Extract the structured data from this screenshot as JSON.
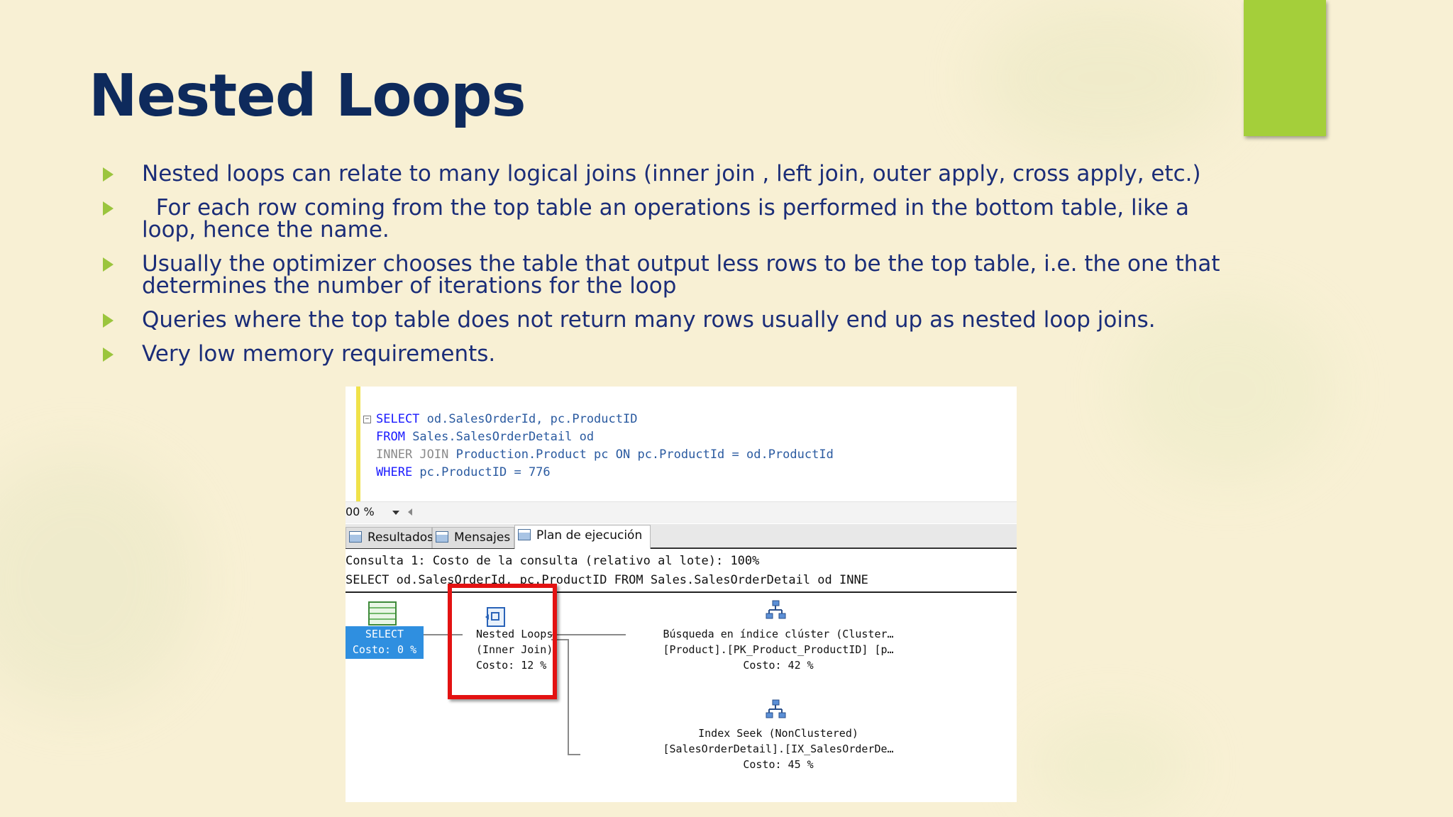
{
  "slide": {
    "title": "Nested Loops",
    "bullets": [
      "Nested loops can relate to many logical joins (inner join , left join, outer apply, cross apply, etc.)",
      "  For each row coming from the top table an operations is performed in the bottom table, like a loop, hence the name.",
      "Usually the optimizer chooses the table that output less rows to be the top table, i.e. the one that determines the number of iterations for the loop",
      "Queries where the top table does not return many rows usually end up as nested loop joins.",
      "Very low memory requirements."
    ],
    "colors": {
      "title": "#0e2a5c",
      "text": "#1b2d78",
      "accent": "#a4cf3a",
      "background": "#f8f0d4"
    }
  },
  "screenshot": {
    "editor": {
      "lines": [
        {
          "kw": "SELECT",
          "rest": " od.SalesOrderId, pc.ProductID"
        },
        {
          "kw": "FROM",
          "rest": " Sales.SalesOrderDetail od"
        },
        {
          "kw": "INNER JOIN",
          "rest": " Production.Product pc ON pc.ProductId = od.ProductId"
        },
        {
          "kw": "WHERE",
          "rest": " pc.ProductID = 776"
        }
      ]
    },
    "zoom": "00 %",
    "tabs": {
      "results": "Resultados",
      "messages": "Mensajes",
      "plan": "Plan de ejecución"
    },
    "query_cost": "Consulta 1: Costo de la consulta (relativo al lote): 100%",
    "query_text": "SELECT od.SalesOrderId, pc.ProductID FROM Sales.SalesOrderDetail od INNE",
    "plan": {
      "select": {
        "name": "SELECT",
        "cost": "Costo: 0 %"
      },
      "nested_loops": {
        "name": "Nested Loops",
        "join": "(Inner Join)",
        "cost": "Costo: 12 %"
      },
      "clustered_seek": {
        "name": "Búsqueda en índice clúster (Cluster…",
        "object": "[Product].[PK_Product_ProductID] [p…",
        "cost": "Costo: 42 %"
      },
      "index_seek": {
        "name": "Index Seek (NonClustered)",
        "object": "[SalesOrderDetail].[IX_SalesOrderDe…",
        "cost": "Costo: 45 %"
      }
    }
  }
}
